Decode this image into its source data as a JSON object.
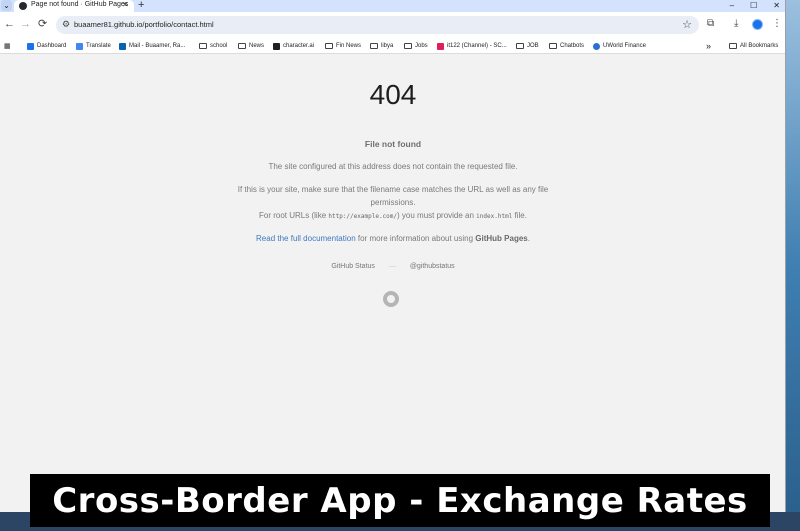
{
  "tab": {
    "title": "Page not found · GitHub Pages",
    "close": "✕",
    "new_tab": "+"
  },
  "window_controls": {
    "minimize": "–",
    "maximize": "☐",
    "close": "✕"
  },
  "toolbar": {
    "back": "←",
    "forward": "→",
    "reload": "⟳",
    "url": "buaamer81.github.io/portfolio/contact.html",
    "bookmark_icon": "star-icon",
    "extensions_icon": "puzzle-icon",
    "download_icon": "download-icon",
    "menu_icon": "⋮"
  },
  "bookmarks": [
    {
      "label": "Dashboard",
      "icon": "dashboard-icon"
    },
    {
      "label": "Translate",
      "icon": "translate-icon"
    },
    {
      "label": "Mail - Buaamer, Ra...",
      "icon": "outlook-icon"
    },
    {
      "label": "school",
      "icon": "folder-icon"
    },
    {
      "label": "News",
      "icon": "folder-icon"
    },
    {
      "label": "character.ai",
      "icon": "character-ai-icon"
    },
    {
      "label": "Fin News",
      "icon": "folder-icon"
    },
    {
      "label": "libya",
      "icon": "folder-icon"
    },
    {
      "label": "Jobs",
      "icon": "folder-icon"
    },
    {
      "label": "it122 (Channel) - SC...",
      "icon": "slack-icon"
    },
    {
      "label": "JOB",
      "icon": "folder-icon"
    },
    {
      "label": "Chatbots",
      "icon": "folder-icon"
    },
    {
      "label": "UWorld Finance",
      "icon": "uworld-icon"
    }
  ],
  "bookmarks_overflow": "»",
  "all_bookmarks": "All Bookmarks",
  "page": {
    "status_code": "404",
    "heading": "File not found",
    "para1": "The site configured at this address does not contain the requested file.",
    "para2": "If this is your site, make sure that the filename case matches the URL as well as any file permissions.",
    "para3_prefix": "For root URLs (like ",
    "para3_code1": "http://example.com/",
    "para3_mid": ") you must provide an ",
    "para3_code2": "index.html",
    "para3_suffix": " file.",
    "doc_link": "Read the full documentation",
    "doc_rest": " for more information about using ",
    "doc_bold": "GitHub Pages",
    "doc_end": ".",
    "footer_status": "GitHub Status",
    "footer_sep": "—",
    "footer_handle": "@githubstatus"
  },
  "caption": "Cross-Border App - Exchange Rates"
}
